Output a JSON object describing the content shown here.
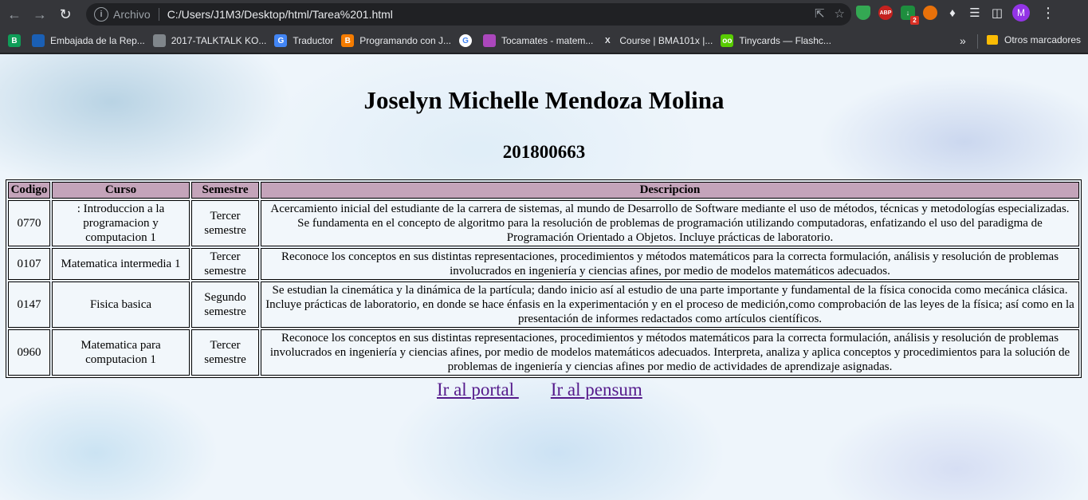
{
  "browser": {
    "scheme_label": "Archivo",
    "url": "C:/Users/J1M3/Desktop/html/Tarea%201.html",
    "avatar_letter": "M",
    "ext_abp": "ABP",
    "ext_badge": "2",
    "bookmarks": [
      {
        "label": "",
        "icon": "B",
        "color": "#0f9d58"
      },
      {
        "label": "Embajada de la Rep...",
        "icon": "",
        "color": "#1a5fb4"
      },
      {
        "label": "2017-TALKTALK KO...",
        "icon": "",
        "color": "#80868b"
      },
      {
        "label": "Traductor",
        "icon": "G",
        "color": "#4285f4"
      },
      {
        "label": "Programando con J...",
        "icon": "B",
        "color": "#f57c00"
      },
      {
        "label": "",
        "icon": "G",
        "color": "#ffffff"
      },
      {
        "label": "Tocamates - matem...",
        "icon": "",
        "color": "#ab47bc"
      },
      {
        "label": "Course | BMA101x |...",
        "icon": "X",
        "color": "#35363a"
      },
      {
        "label": "Tinycards — Flashc...",
        "icon": "oo",
        "color": "#58cc02"
      }
    ],
    "more_label": "»",
    "other_bookmarks": "Otros marcadores"
  },
  "page": {
    "title": "Joselyn Michelle Mendoza Molina",
    "subtitle": "201800663",
    "table": {
      "headers": [
        "Codigo",
        "Curso",
        "Semestre",
        "Descripcion"
      ],
      "rows": [
        {
          "code": "0770",
          "course": ": Introduccion a la programacion y computacion 1",
          "semester": "Tercer semestre",
          "description": "Acercamiento inicial del estudiante de la carrera de sistemas, al mundo de Desarrollo de Software mediante el uso de métodos, técnicas y metodologías especializadas. Se fundamenta en el concepto de algoritmo para la resolución de problemas de programación utilizando computadoras, enfatizando el uso del paradigma de Programación Orientado a Objetos. Incluye prácticas de laboratorio."
        },
        {
          "code": "0107",
          "course": "Matematica intermedia 1",
          "semester": "Tercer semestre",
          "description": "Reconoce los conceptos en sus distintas representaciones, procedimientos y métodos matemáticos para la correcta formulación, análisis y resolución de problemas involucrados en ingeniería y ciencias afines, por medio de modelos matemáticos adecuados."
        },
        {
          "code": "0147",
          "course": "Fisica basica",
          "semester": "Segundo semestre",
          "description": "Se estudian la cinemática y la dinámica de la partícula; dando inicio así al estudio de una parte importante y fundamental de la física conocida como mecánica clásica. Incluye prácticas de laboratorio, en donde se hace énfasis en la experimentación y en el proceso de medición,como comprobación de las leyes de la física; así como en la presentación de informes redactados como artículos científicos."
        },
        {
          "code": "0960",
          "course": "Matematica para computacion 1",
          "semester": "Tercer semestre",
          "description": "Reconoce los conceptos en sus distintas representaciones, procedimientos y métodos matemáticos para la correcta formulación, análisis y resolución de problemas involucrados en ingeniería y ciencias afines, por medio de modelos matemáticos adecuados. Interpreta, analiza y aplica conceptos y procedimientos para la solución de problemas de ingeniería y ciencias afines por medio de actividades de aprendizaje asignadas."
        }
      ]
    },
    "links": {
      "portal": "Ir al portal ",
      "pensum": "Ir al pensum"
    }
  }
}
